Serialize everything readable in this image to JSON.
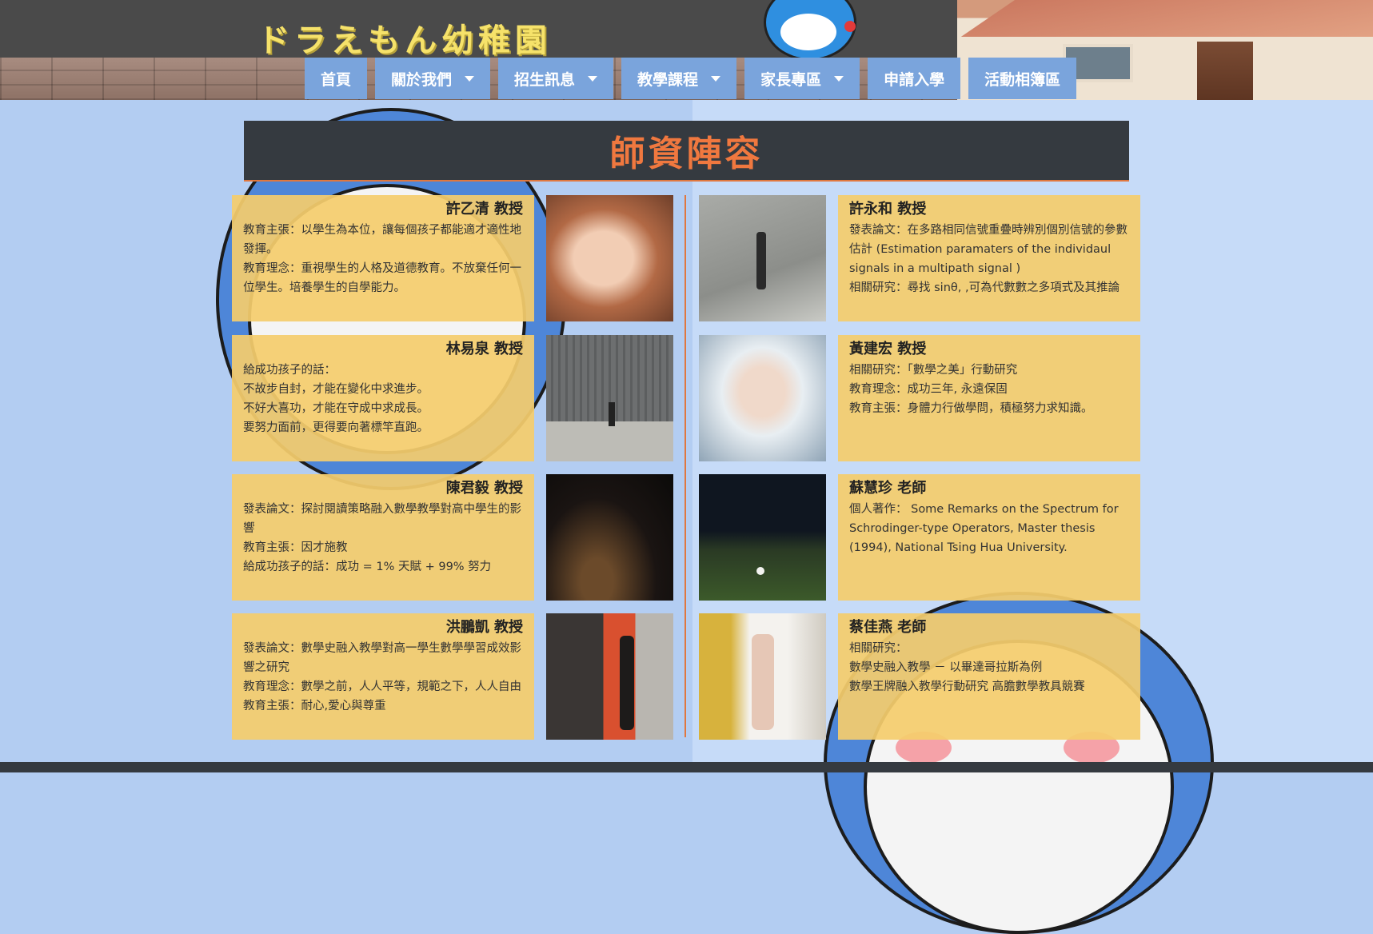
{
  "header": {
    "logo_text": "ドラえもん幼稚園"
  },
  "nav": [
    {
      "label": "首頁",
      "dropdown": false
    },
    {
      "label": "關於我們",
      "dropdown": true
    },
    {
      "label": "招生訊息",
      "dropdown": true
    },
    {
      "label": "教學課程",
      "dropdown": true
    },
    {
      "label": "家長專區",
      "dropdown": true
    },
    {
      "label": "申請入學",
      "dropdown": false
    },
    {
      "label": "活動相簿區",
      "dropdown": false
    }
  ],
  "page_title": "師資陣容",
  "teachers": [
    {
      "name": "許乙清 教授",
      "lines": [
        "教育主張：以學生為本位，讓每個孩子都能適才適性地發揮。",
        "教育理念：重視學生的人格及道德教育。不放棄任何一位學生。培養學生的自學能力。"
      ]
    },
    {
      "name": "許永和 教授",
      "lines": [
        "發表論文：在多路相同信號重疊時辨別個別信號的參數估計 (Estimation paramaters of the individaul signals in a multipath signal )",
        "相關研究：尋找 sinθ, ,可為代數數之多項式及其推論"
      ]
    },
    {
      "name": "林易泉 教授",
      "lines": [
        "給成功孩子的話：",
        "不故步自封，才能在變化中求進步。",
        "不好大喜功，才能在守成中求成長。",
        "要努力面前，更得要向著標竿直跑。"
      ]
    },
    {
      "name": "黃建宏 教授",
      "lines": [
        "相關研究：「數學之美」行動研究",
        "教育理念：成功三年, 永遠保固",
        "教育主張：身體力行做學問，積極努力求知識。"
      ]
    },
    {
      "name": "陳君毅 教授",
      "lines": [
        "發表論文：探討閱讀策略融入數學教學對高中學生的影響",
        "教育主張：因才施教",
        "給成功孩子的話：成功 = 1% 天賦 + 99% 努力"
      ]
    },
    {
      "name": "蘇慧珍 老師",
      "lines": [
        "個人著作： Some Remarks on the Spectrum for Schrodinger-type Operators, Master thesis (1994), National Tsing Hua University."
      ]
    },
    {
      "name": "洪鵬凱 教授",
      "lines": [
        "發表論文：數學史融入教學對高一學生數學學習成效影響之研究",
        "教育理念：數學之前，人人平等，規範之下，人人自由",
        "教育主張：耐心,愛心與尊重"
      ]
    },
    {
      "name": "蔡佳燕 老師",
      "lines": [
        "相關研究：",
        "數學史融入教學 － 以畢達哥拉斯為例",
        "數學王牌融入教學行動研究 高膽數學教具競賽"
      ]
    }
  ],
  "colors": {
    "accent": "#f0783f",
    "nav_bg": "#7aa4dc",
    "card_bg": "#f4cc6d",
    "title_bg": "#353a40"
  }
}
